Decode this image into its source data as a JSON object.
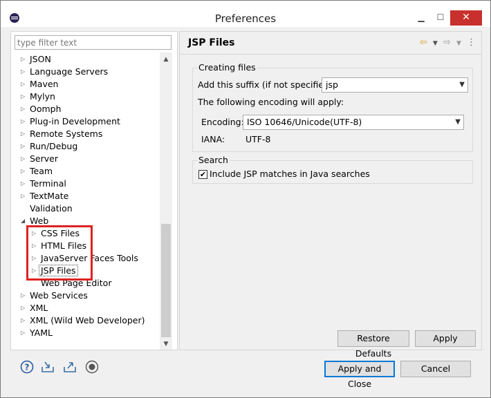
{
  "window": {
    "title": "Preferences",
    "minimize": "▁",
    "maximize": "☐",
    "close": "✕"
  },
  "filter": {
    "placeholder": "type filter text"
  },
  "tree": {
    "items": [
      {
        "label": "JSON",
        "expandable": true,
        "level": 1
      },
      {
        "label": "Language Servers",
        "expandable": true,
        "level": 1
      },
      {
        "label": "Maven",
        "expandable": true,
        "level": 1
      },
      {
        "label": "Mylyn",
        "expandable": true,
        "level": 1
      },
      {
        "label": "Oomph",
        "expandable": true,
        "level": 1
      },
      {
        "label": "Plug-in Development",
        "expandable": true,
        "level": 1
      },
      {
        "label": "Remote Systems",
        "expandable": true,
        "level": 1
      },
      {
        "label": "Run/Debug",
        "expandable": true,
        "level": 1
      },
      {
        "label": "Server",
        "expandable": true,
        "level": 1
      },
      {
        "label": "Team",
        "expandable": true,
        "level": 1
      },
      {
        "label": "Terminal",
        "expandable": true,
        "level": 1
      },
      {
        "label": "TextMate",
        "expandable": true,
        "level": 1
      },
      {
        "label": "Validation",
        "expandable": false,
        "level": 1
      },
      {
        "label": "Web",
        "expandable": true,
        "expanded": true,
        "level": 1
      },
      {
        "label": "CSS Files",
        "expandable": true,
        "level": 2
      },
      {
        "label": "HTML Files",
        "expandable": true,
        "level": 2
      },
      {
        "label": "JavaServer Faces Tools",
        "expandable": true,
        "level": 2
      },
      {
        "label": "JSP Files",
        "expandable": true,
        "level": 2,
        "selected": true
      },
      {
        "label": "Web Page Editor",
        "expandable": false,
        "level": 2
      },
      {
        "label": "Web Services",
        "expandable": true,
        "level": 1
      },
      {
        "label": "XML",
        "expandable": true,
        "level": 1
      },
      {
        "label": "XML (Wild Web Developer)",
        "expandable": true,
        "level": 1
      },
      {
        "label": "YAML",
        "expandable": true,
        "level": 1
      }
    ]
  },
  "page": {
    "title": "JSP Files",
    "creating_files": {
      "label": "Creating files",
      "suffix_label": "Add this suffix (if not specified):",
      "suffix_value": "jsp",
      "encoding_note": "The following encoding will apply:",
      "encoding_label": "Encoding:",
      "encoding_value": "ISO 10646/Unicode(UTF-8)",
      "iana_label": "IANA:",
      "iana_value": "UTF-8"
    },
    "search": {
      "label": "Search",
      "include_label": "Include JSP matches in Java searches",
      "include_checked": true
    },
    "restore_defaults": "Restore Defaults",
    "apply": "Apply"
  },
  "footer": {
    "apply_and_close": "Apply and Close",
    "cancel": "Cancel"
  },
  "icons": {
    "help": "help-icon",
    "import": "import-icon",
    "export": "export-icon",
    "record": "record-icon",
    "back": "back-arrow-icon",
    "forward": "forward-arrow-icon",
    "menu": "view-menu-icon"
  },
  "colors": {
    "highlight": "#e02020",
    "primary_border": "#0078d7",
    "close_button": "#c7302c"
  }
}
